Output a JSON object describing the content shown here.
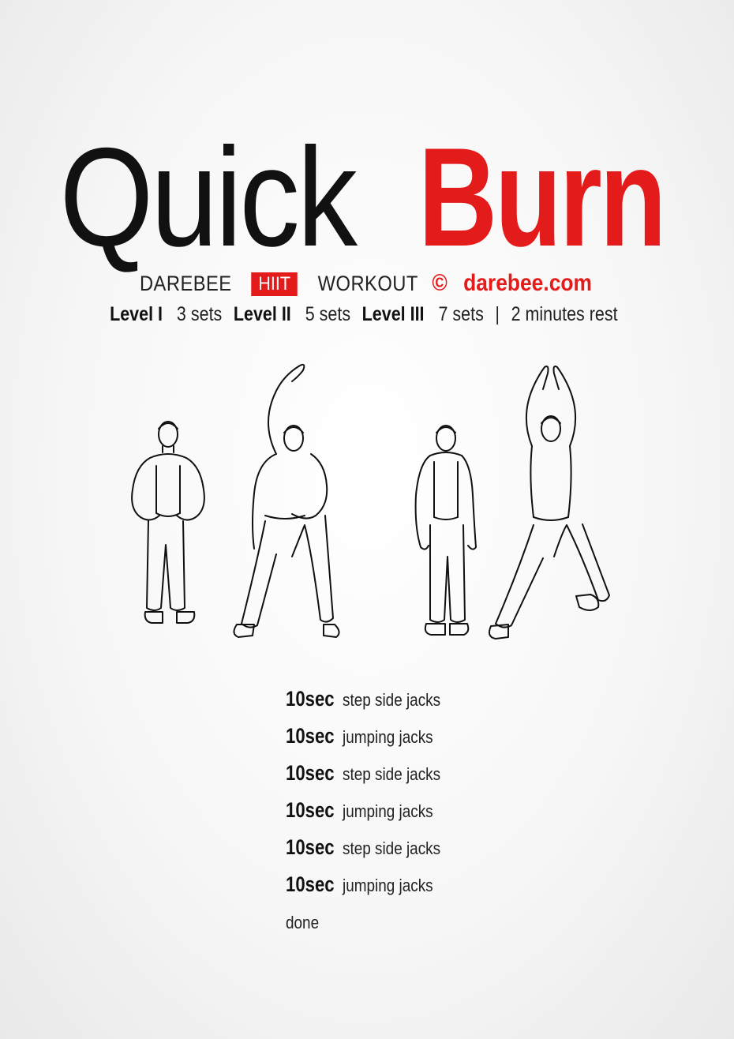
{
  "title": {
    "part1": "Quick",
    "part2": "Burn"
  },
  "subline": {
    "brand": "DAREBEE",
    "badge": "HIIT",
    "workout": "WORKOUT",
    "copyright": "©",
    "site": "darebee.com"
  },
  "levels": [
    {
      "label": "Level I",
      "value": "3 sets"
    },
    {
      "label": "Level II",
      "value": "5 sets"
    },
    {
      "label": "Level III",
      "value": "7 sets"
    }
  ],
  "rest": {
    "separator": "|",
    "text": "2 minutes rest"
  },
  "exercises": [
    {
      "duration": "10sec",
      "name": "step side jacks"
    },
    {
      "duration": "10sec",
      "name": "jumping jacks"
    },
    {
      "duration": "10sec",
      "name": "step side jacks"
    },
    {
      "duration": "10sec",
      "name": "jumping jacks"
    },
    {
      "duration": "10sec",
      "name": "step side jacks"
    },
    {
      "duration": "10sec",
      "name": "jumping jacks"
    }
  ],
  "done": "done",
  "colors": {
    "accent": "#e41b1b",
    "text": "#111111",
    "background": "#f4f4f4"
  },
  "illustrations": [
    "step-side-jacks-standing",
    "step-side-jacks-reach",
    "jumping-jacks-standing",
    "jumping-jacks-arms-up"
  ]
}
